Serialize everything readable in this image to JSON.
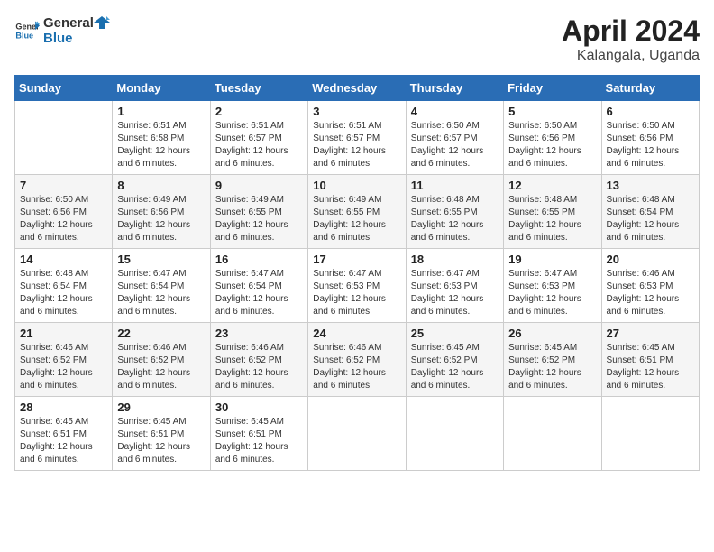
{
  "header": {
    "logo_general": "General",
    "logo_blue": "Blue",
    "title": "April 2024",
    "location": "Kalangala, Uganda"
  },
  "calendar": {
    "weekdays": [
      "Sunday",
      "Monday",
      "Tuesday",
      "Wednesday",
      "Thursday",
      "Friday",
      "Saturday"
    ],
    "weeks": [
      [
        {
          "day": "",
          "info": ""
        },
        {
          "day": "1",
          "info": "Sunrise: 6:51 AM\nSunset: 6:58 PM\nDaylight: 12 hours\nand 6 minutes."
        },
        {
          "day": "2",
          "info": "Sunrise: 6:51 AM\nSunset: 6:57 PM\nDaylight: 12 hours\nand 6 minutes."
        },
        {
          "day": "3",
          "info": "Sunrise: 6:51 AM\nSunset: 6:57 PM\nDaylight: 12 hours\nand 6 minutes."
        },
        {
          "day": "4",
          "info": "Sunrise: 6:50 AM\nSunset: 6:57 PM\nDaylight: 12 hours\nand 6 minutes."
        },
        {
          "day": "5",
          "info": "Sunrise: 6:50 AM\nSunset: 6:56 PM\nDaylight: 12 hours\nand 6 minutes."
        },
        {
          "day": "6",
          "info": "Sunrise: 6:50 AM\nSunset: 6:56 PM\nDaylight: 12 hours\nand 6 minutes."
        }
      ],
      [
        {
          "day": "7",
          "info": "Sunrise: 6:50 AM\nSunset: 6:56 PM\nDaylight: 12 hours\nand 6 minutes."
        },
        {
          "day": "8",
          "info": "Sunrise: 6:49 AM\nSunset: 6:56 PM\nDaylight: 12 hours\nand 6 minutes."
        },
        {
          "day": "9",
          "info": "Sunrise: 6:49 AM\nSunset: 6:55 PM\nDaylight: 12 hours\nand 6 minutes."
        },
        {
          "day": "10",
          "info": "Sunrise: 6:49 AM\nSunset: 6:55 PM\nDaylight: 12 hours\nand 6 minutes."
        },
        {
          "day": "11",
          "info": "Sunrise: 6:48 AM\nSunset: 6:55 PM\nDaylight: 12 hours\nand 6 minutes."
        },
        {
          "day": "12",
          "info": "Sunrise: 6:48 AM\nSunset: 6:55 PM\nDaylight: 12 hours\nand 6 minutes."
        },
        {
          "day": "13",
          "info": "Sunrise: 6:48 AM\nSunset: 6:54 PM\nDaylight: 12 hours\nand 6 minutes."
        }
      ],
      [
        {
          "day": "14",
          "info": "Sunrise: 6:48 AM\nSunset: 6:54 PM\nDaylight: 12 hours\nand 6 minutes."
        },
        {
          "day": "15",
          "info": "Sunrise: 6:47 AM\nSunset: 6:54 PM\nDaylight: 12 hours\nand 6 minutes."
        },
        {
          "day": "16",
          "info": "Sunrise: 6:47 AM\nSunset: 6:54 PM\nDaylight: 12 hours\nand 6 minutes."
        },
        {
          "day": "17",
          "info": "Sunrise: 6:47 AM\nSunset: 6:53 PM\nDaylight: 12 hours\nand 6 minutes."
        },
        {
          "day": "18",
          "info": "Sunrise: 6:47 AM\nSunset: 6:53 PM\nDaylight: 12 hours\nand 6 minutes."
        },
        {
          "day": "19",
          "info": "Sunrise: 6:47 AM\nSunset: 6:53 PM\nDaylight: 12 hours\nand 6 minutes."
        },
        {
          "day": "20",
          "info": "Sunrise: 6:46 AM\nSunset: 6:53 PM\nDaylight: 12 hours\nand 6 minutes."
        }
      ],
      [
        {
          "day": "21",
          "info": "Sunrise: 6:46 AM\nSunset: 6:52 PM\nDaylight: 12 hours\nand 6 minutes."
        },
        {
          "day": "22",
          "info": "Sunrise: 6:46 AM\nSunset: 6:52 PM\nDaylight: 12 hours\nand 6 minutes."
        },
        {
          "day": "23",
          "info": "Sunrise: 6:46 AM\nSunset: 6:52 PM\nDaylight: 12 hours\nand 6 minutes."
        },
        {
          "day": "24",
          "info": "Sunrise: 6:46 AM\nSunset: 6:52 PM\nDaylight: 12 hours\nand 6 minutes."
        },
        {
          "day": "25",
          "info": "Sunrise: 6:45 AM\nSunset: 6:52 PM\nDaylight: 12 hours\nand 6 minutes."
        },
        {
          "day": "26",
          "info": "Sunrise: 6:45 AM\nSunset: 6:52 PM\nDaylight: 12 hours\nand 6 minutes."
        },
        {
          "day": "27",
          "info": "Sunrise: 6:45 AM\nSunset: 6:51 PM\nDaylight: 12 hours\nand 6 minutes."
        }
      ],
      [
        {
          "day": "28",
          "info": "Sunrise: 6:45 AM\nSunset: 6:51 PM\nDaylight: 12 hours\nand 6 minutes."
        },
        {
          "day": "29",
          "info": "Sunrise: 6:45 AM\nSunset: 6:51 PM\nDaylight: 12 hours\nand 6 minutes."
        },
        {
          "day": "30",
          "info": "Sunrise: 6:45 AM\nSunset: 6:51 PM\nDaylight: 12 hours\nand 6 minutes."
        },
        {
          "day": "",
          "info": ""
        },
        {
          "day": "",
          "info": ""
        },
        {
          "day": "",
          "info": ""
        },
        {
          "day": "",
          "info": ""
        }
      ]
    ]
  }
}
